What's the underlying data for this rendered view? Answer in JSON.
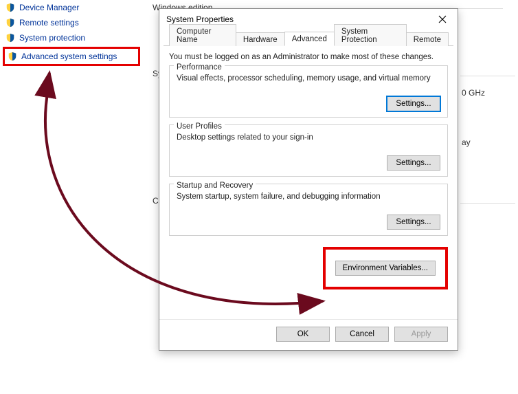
{
  "background": {
    "windows_edition_label": "Windows edition",
    "sy_label": "Sy",
    "c_label": "C",
    "ghz_fragment": "0 GHz",
    "ay_fragment": "ay"
  },
  "sidebar": {
    "items": [
      {
        "label": "Device Manager"
      },
      {
        "label": "Remote settings"
      },
      {
        "label": "System protection"
      },
      {
        "label": "Advanced system settings"
      }
    ]
  },
  "dialog": {
    "title": "System Properties",
    "tabs": {
      "computer_name": "Computer Name",
      "hardware": "Hardware",
      "advanced": "Advanced",
      "system_protection": "System Protection",
      "remote": "Remote"
    },
    "admin_note": "You must be logged on as an Administrator to make most of these changes.",
    "performance": {
      "title": "Performance",
      "desc": "Visual effects, processor scheduling, memory usage, and virtual memory",
      "button": "Settings..."
    },
    "user_profiles": {
      "title": "User Profiles",
      "desc": "Desktop settings related to your sign-in",
      "button": "Settings..."
    },
    "startup": {
      "title": "Startup and Recovery",
      "desc": "System startup, system failure, and debugging information",
      "button": "Settings..."
    },
    "env_button": "Environment Variables...",
    "buttons": {
      "ok": "OK",
      "cancel": "Cancel",
      "apply": "Apply"
    }
  }
}
